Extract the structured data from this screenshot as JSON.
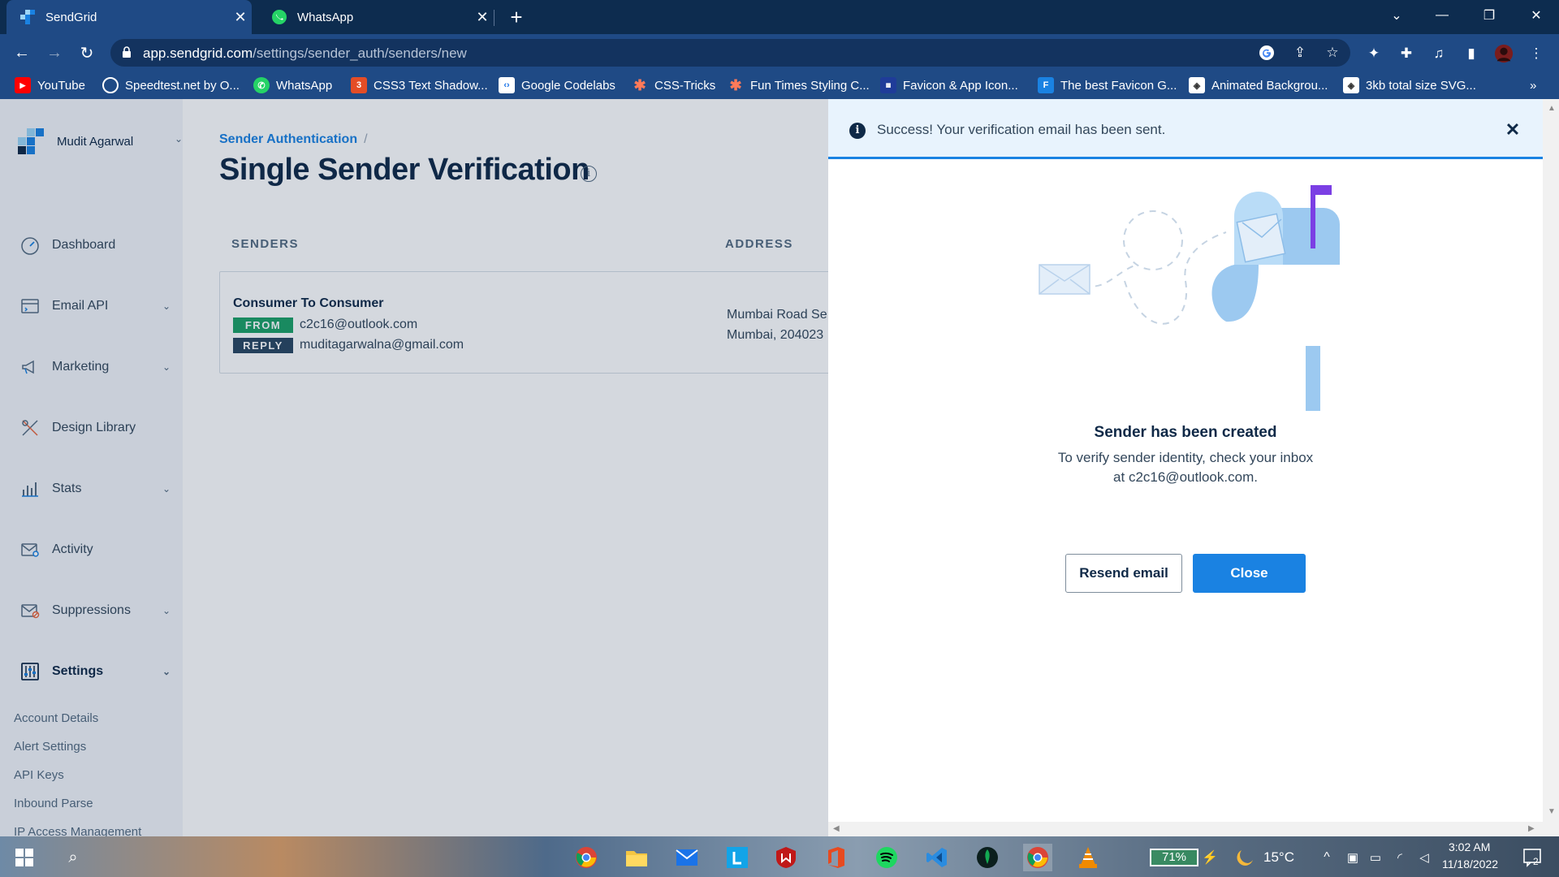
{
  "browser": {
    "tabs": [
      {
        "title": "SendGrid",
        "active": true
      },
      {
        "title": "WhatsApp",
        "active": false
      }
    ],
    "url_host": "app.sendgrid.com",
    "url_path": "/settings/sender_auth/senders/new",
    "bookmarks": [
      "YouTube",
      "Speedtest.net by O...",
      "WhatsApp",
      "CSS3 Text Shadow...",
      "Google Codelabs",
      "CSS-Tricks",
      "Fun Times Styling C...",
      "Favicon & App Icon...",
      "The best Favicon G...",
      "Animated Backgrou...",
      "3kb total size SVG..."
    ],
    "bookmark_more": "»"
  },
  "sidebar": {
    "account_name": "Mudit Agarwal",
    "items": [
      {
        "label": "Dashboard",
        "icon": "dashboard-icon"
      },
      {
        "label": "Email API",
        "icon": "email-api-icon"
      },
      {
        "label": "Marketing",
        "icon": "megaphone-icon"
      },
      {
        "label": "Design Library",
        "icon": "design-library-icon"
      },
      {
        "label": "Stats",
        "icon": "stats-icon"
      },
      {
        "label": "Activity",
        "icon": "activity-icon"
      },
      {
        "label": "Suppressions",
        "icon": "suppressions-icon"
      },
      {
        "label": "Settings",
        "icon": "settings-icon"
      }
    ],
    "settings_sub": [
      "Account Details",
      "Alert Settings",
      "API Keys",
      "Inbound Parse",
      "IP Access Management"
    ]
  },
  "main": {
    "breadcrumb": "Sender Authentication",
    "breadcrumb_sep": "/",
    "title": "Single Sender Verification",
    "info_glyph": "i",
    "columns": [
      "SENDERS",
      "ADDRESS"
    ],
    "sender": {
      "name": "Consumer To Consumer",
      "from_label": "FROM",
      "from_email": "c2c16@outlook.com",
      "reply_label": "REPLY",
      "reply_email": "muditagarwalna@gmail.com",
      "address_line1": "Mumbai Road Se",
      "address_line2": "Mumbai, 204023"
    }
  },
  "panel": {
    "alert_glyph": "i",
    "alert_text": "Success! Your verification email has been sent.",
    "alert_close": "✕",
    "heading": "Sender has been created",
    "line1": "To verify sender identity, check your inbox",
    "line2": "at c2c16@outlook.com.",
    "resend_label": "Resend email",
    "close_label": "Close"
  },
  "taskbar": {
    "battery": "71%",
    "temperature": "15°C",
    "time": "3:02 AM",
    "date": "11/18/2022",
    "notifications": "2"
  },
  "colors": {
    "brand_blue": "#1a82e2",
    "navy": "#0f2947",
    "from_green": "#1ca066",
    "reply_navy": "#294661",
    "flag_purple": "#7b3fe4"
  }
}
